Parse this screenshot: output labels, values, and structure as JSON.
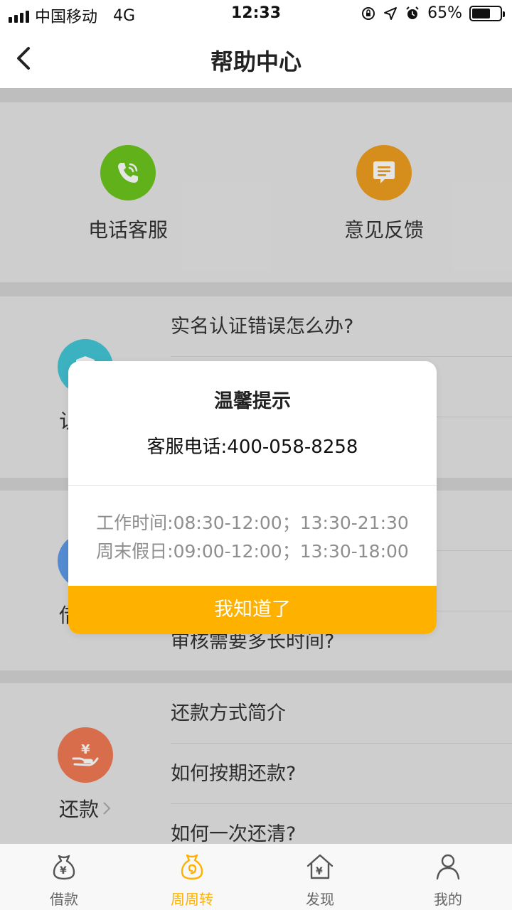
{
  "status_bar": {
    "carrier": "中国移动",
    "network": "4G",
    "time": "12:33",
    "battery_percent": "65%",
    "battery_level": 0.65
  },
  "header": {
    "title": "帮助中心"
  },
  "contacts": [
    {
      "label": "电话客服",
      "icon": "phone-icon",
      "color": "#6cc61e"
    },
    {
      "label": "意见反馈",
      "icon": "message-icon",
      "color": "#ee9d20"
    }
  ],
  "categories": [
    {
      "label": "认证",
      "icon": "shield-icon",
      "color": "#43c7d6",
      "faqs": [
        "实名认证错误怎么办?",
        "",
        ""
      ]
    },
    {
      "label": "借款",
      "icon": "document-icon",
      "color": "#5e9be8",
      "faqs": [
        "",
        "",
        "审核需要多长时间?"
      ]
    },
    {
      "label": "还款",
      "icon": "repay-icon",
      "color": "#f07a54",
      "faqs": [
        "还款方式简介",
        "如何按期还款?",
        "如何一次还清?"
      ]
    }
  ],
  "dialog": {
    "title": "温馨提示",
    "phone": "客服电话:400-058-8258",
    "hours_weekday": "工作时间:08:30-12:00；13:30-21:30",
    "hours_weekend": "周末假日:09:00-12:00；13:30-18:00",
    "button": "我知道了"
  },
  "tabs": [
    {
      "label": "借款",
      "icon": "loan-bag-icon",
      "active": false
    },
    {
      "label": "周周转",
      "icon": "spiral-bag-icon",
      "active": true
    },
    {
      "label": "发现",
      "icon": "discover-house-icon",
      "active": false
    },
    {
      "label": "我的",
      "icon": "person-icon",
      "active": false
    }
  ],
  "colors": {
    "accent": "#ffb100",
    "overlay": "rgba(0,0,0,0.1)"
  }
}
